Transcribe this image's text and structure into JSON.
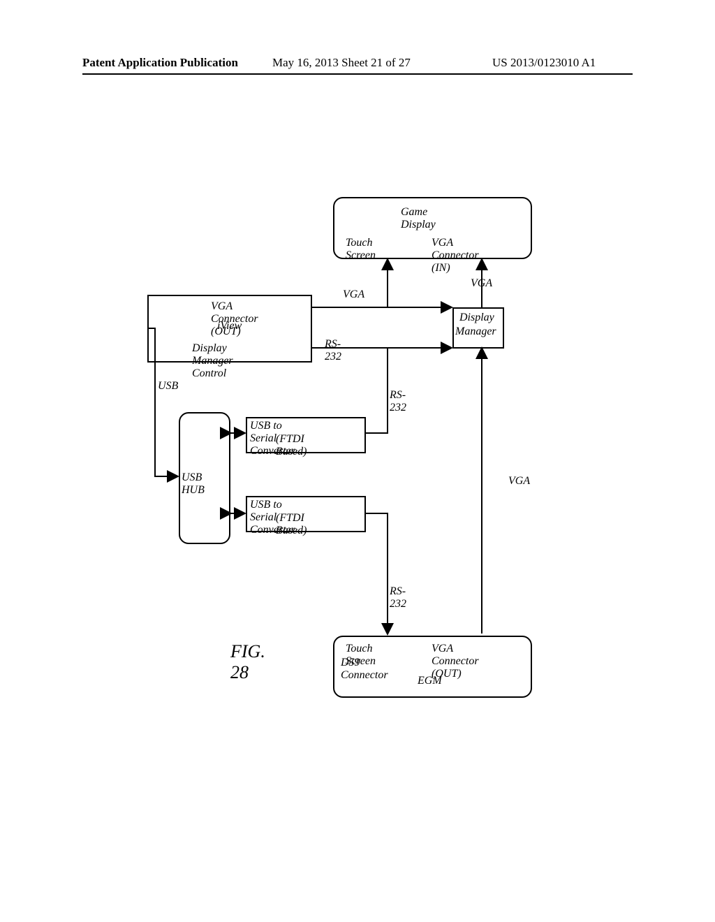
{
  "header": {
    "left": "Patent Application Publication",
    "center": "May 16, 2013  Sheet 21 of 27",
    "right": "US 2013/0123010 A1"
  },
  "boxes": {
    "game_display": {
      "title": "Game Display",
      "port_left": "Touch Screen",
      "port_right": "VGA Connector (IN)"
    },
    "iview": {
      "port_top": "VGA Connector (OUT)",
      "title": "iView",
      "port_bottom": "Display Manager Control"
    },
    "display_manager": {
      "line1": "Display",
      "line2": "Manager"
    },
    "usb_hub": "USB HUB",
    "converter1": {
      "line1": "USB to Serial Converter",
      "line2": "(FTDI Based)"
    },
    "converter2": {
      "line1": "USB to Serial Converter",
      "line2": "(FTDI Based)"
    },
    "egm": {
      "port_left_1": "Touch Screen",
      "port_left_2": "D59 Connector",
      "port_right": "VGA Connector (OUT)",
      "title": "EGM"
    }
  },
  "connectors": {
    "vga_top_right": "VGA",
    "vga_mid": "VGA",
    "rs232_mid": "RS-232",
    "usb": "USB",
    "rs232_mid2": "RS-232",
    "vga_right": "VGA",
    "rs232_bottom": "RS-232"
  },
  "figure_label": "FIG. 28"
}
